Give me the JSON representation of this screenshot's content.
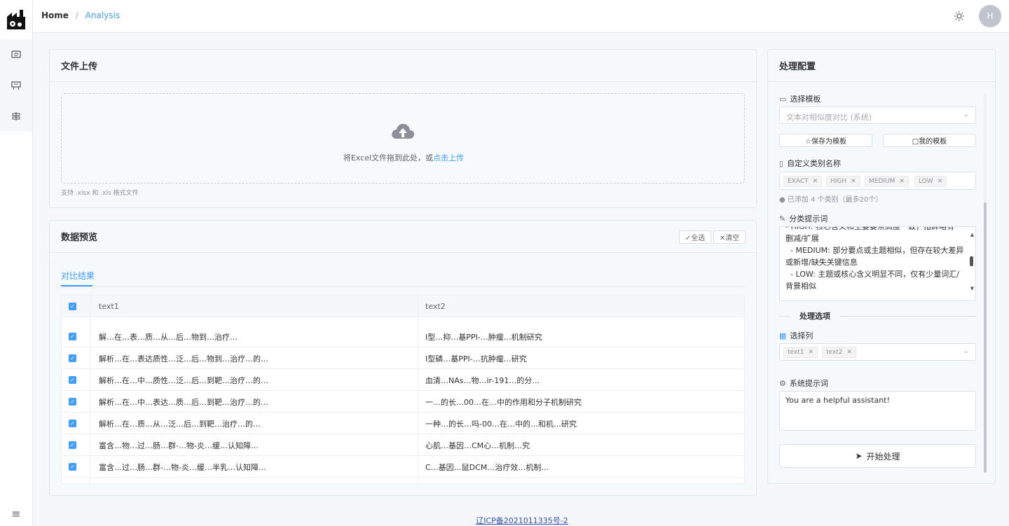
{
  "breadcrumb": {
    "home": "Home",
    "separator": "/",
    "current": "Analysis"
  },
  "header": {
    "avatar_initial": "H"
  },
  "upload": {
    "title": "文件上传",
    "drop_text": "将Excel文件拖到此处，或",
    "drop_link": "点击上传",
    "hint": "支持 .xlsx 和 .xls 格式文件"
  },
  "preview": {
    "title": "数据预览",
    "select_all": "✓全选",
    "clear": "✕清空",
    "tab": "对比结果",
    "columns": [
      "text1",
      "text2"
    ],
    "rows": [
      {
        "text1": "解…在…表…质…从…后…物到…治疗…",
        "text2": "I型…抑…基PPI-…肿瘤…机制研究"
      },
      {
        "text1": "解析…在…表达质性…泛…后…物到…治疗…的…",
        "text2": "I型磷…基PPI-…抗肿瘤…研究"
      },
      {
        "text1": "解析…在…中…质性…泛…后…到靶…治疗…的…",
        "text2": "血清…NAs…物…ir-191…的分…"
      },
      {
        "text1": "解析…在…中…表达…质…后…到靶…治疗…的…",
        "text2": "一…的长…00…在…中的作用和分子机制研究"
      },
      {
        "text1": "解析…在…质…从…泛…后…到靶…治疗…的…",
        "text2": "一种…的长…吗-00…在…中的…和机…研究"
      },
      {
        "text1": "富含…物…过…肠…群-…物-炎…缓…认知障…",
        "text2": "心肌…基因…CM心…机制…究"
      },
      {
        "text1": "富含…过…肠…群-…物-炎…缓…半乳…认知障…",
        "text2": "C…基因…鼠DCM…治疗效…机制…"
      }
    ]
  },
  "config": {
    "title": "处理配置",
    "template_label": "选择模板",
    "template_value": "文本对相似度对比 (系统)",
    "save_template": "☆保存为模板",
    "my_templates": "□我的模板",
    "category_label": "自定义类别名称",
    "categories": [
      "EXACT",
      "HIGH",
      "MEDIUM",
      "LOW"
    ],
    "category_info": "已添加 4 个类别（最多20个）",
    "prompt_label": "分类提示词",
    "prompt_lines": [
      "- HIGH: 核心含义和主要要点高度一致，措辞略有",
      "删减/扩展",
      "  - MEDIUM: 部分要点或主题相似，但存在较大差异",
      "或新增/缺失关键信息",
      "  - LOW: 主题或核心含义明显不同，仅有少量词汇/",
      "背景相似"
    ],
    "section_title": "处理选项",
    "columns_label": "选择列",
    "selected_columns": [
      "text1",
      "text2"
    ],
    "system_prompt_label": "系统提示词",
    "system_prompt_value": "You are a helpful assistant!",
    "start_button": "开始处理"
  },
  "footer": {
    "icp": "辽ICP备2021011335号-2"
  },
  "colors": {
    "accent": "#409eff"
  }
}
